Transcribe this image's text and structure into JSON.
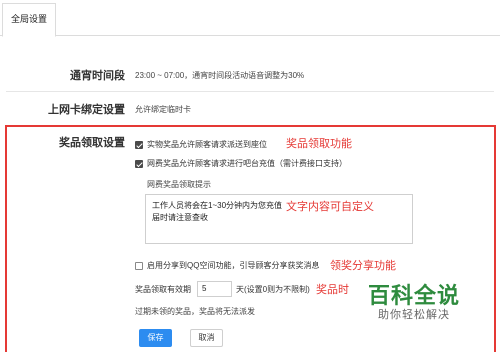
{
  "tabs": [
    {
      "label": "全局设置"
    }
  ],
  "settings": {
    "online_period": {
      "label": "通宵时间段",
      "value": "23:00 ~ 07:00，通宵时间段活动语音调整为30%"
    },
    "card_binding": {
      "label": "上网卡绑定设置",
      "value": "允许绑定临时卡"
    },
    "prize": {
      "label": "奖品领取设置",
      "option_physical": "实物奖品允许顾客请求派送到座位",
      "option_online": "网费奖品允许顾客请求进行吧台充值（需计费接口支持）",
      "tip_title": "网费奖品领取提示",
      "tip_text": "工作人员将会在1~30分钟内为您充值\n届时请注意查收",
      "share_option": "启用分享到QQ空间功能，引导顾客分享获奖消息",
      "expire_label": "奖品领取有效期",
      "expire_value": "5",
      "expire_unit": "天(设置0则为不限制)",
      "expire_note": "过期未领的奖品，奖品将无法派发",
      "save_label": "保存",
      "cancel_label": "取消",
      "physical_checked": true,
      "online_checked": true,
      "share_checked": false
    }
  },
  "annotations": {
    "prize_feature": "奖品领取功能",
    "custom_text": "文字内容可自定义",
    "share_feature": "领奖分享功能",
    "expire_feature": "奖品时"
  },
  "watermark": {
    "main": "百科全说",
    "sub": "助你轻松解决"
  },
  "colors": {
    "accent": "#2d8cf0",
    "annotation": "#e53935",
    "watermark": "#2e8b3e"
  }
}
